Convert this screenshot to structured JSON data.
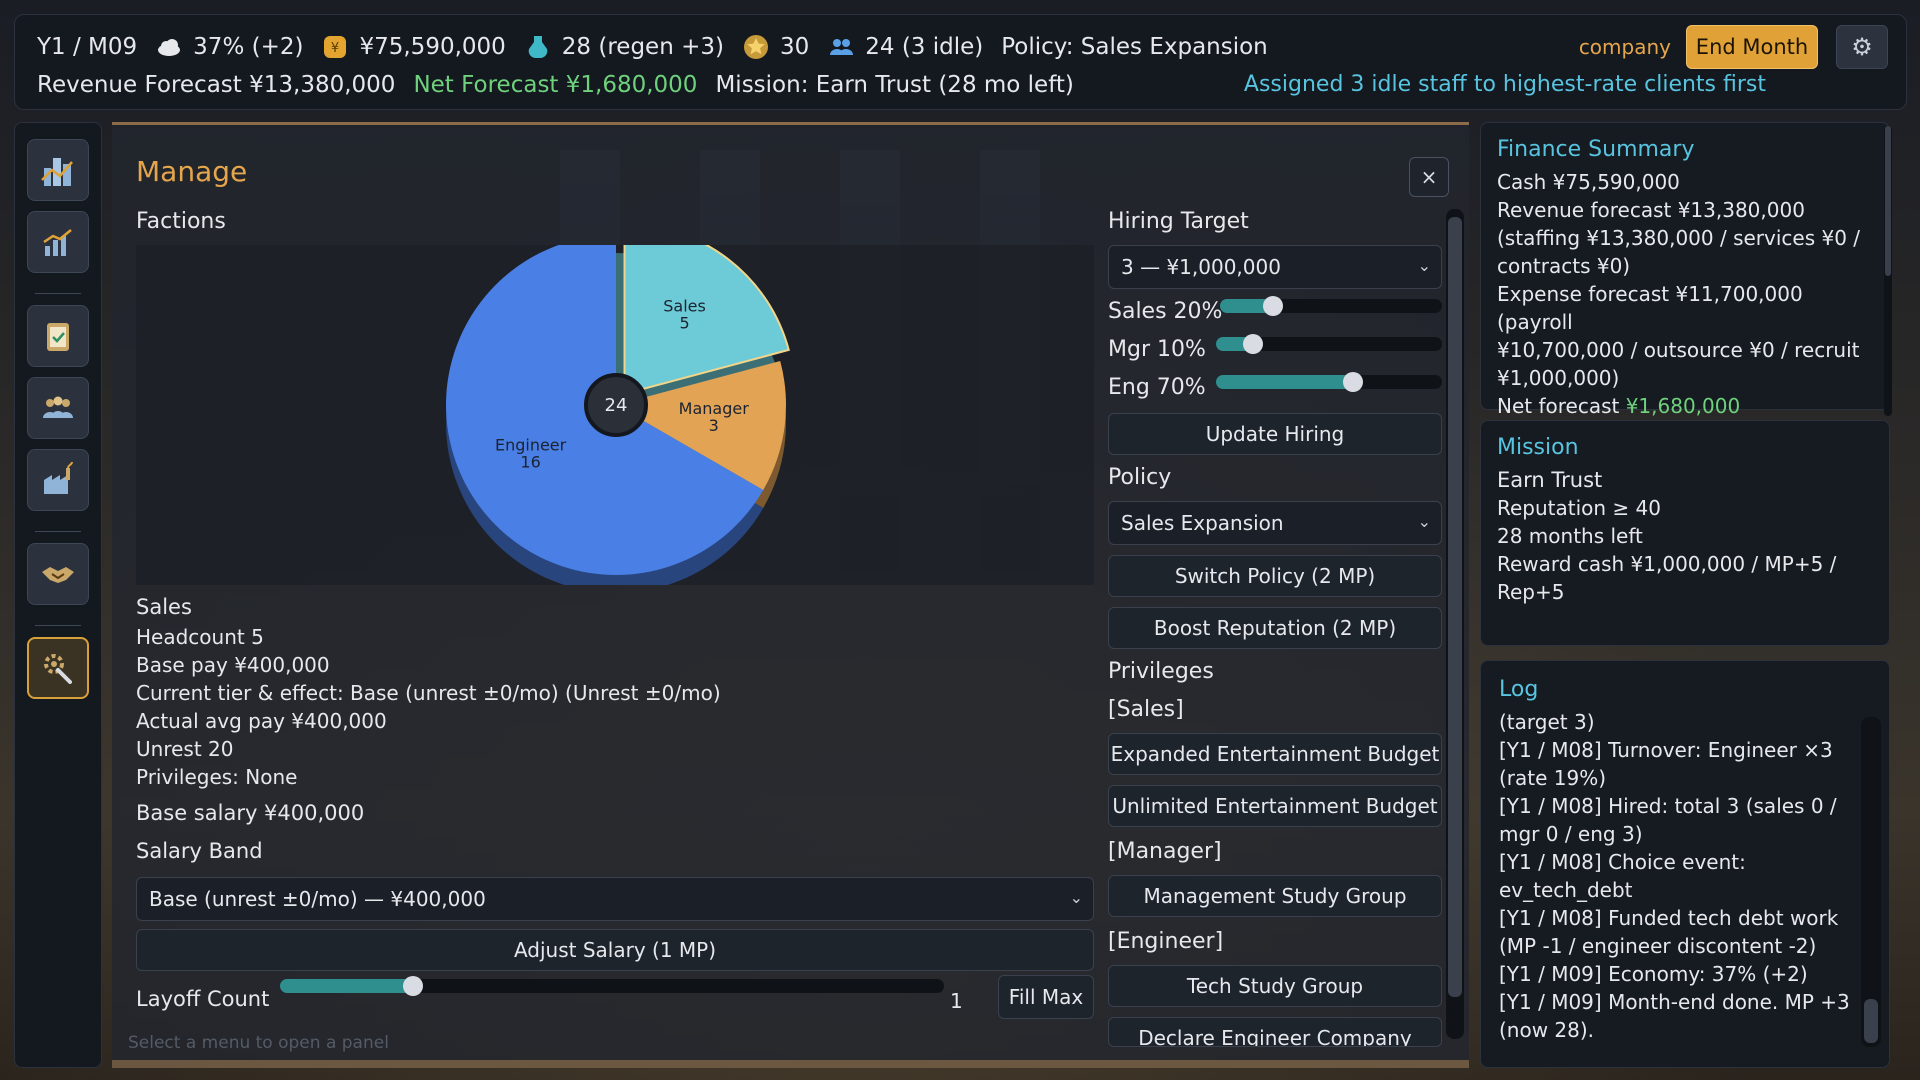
{
  "topbar": {
    "date": "Y1 / M09",
    "economy": "37% (+2)",
    "cash": "¥75,590,000",
    "mp": "28 (regen +3)",
    "reputation": "30",
    "staff": "24 (3 idle)",
    "policy": "Policy: Sales Expansion",
    "revenue_forecast": "Revenue Forecast ¥13,380,000",
    "net_forecast": "Net Forecast ¥1,680,000",
    "mission": "Mission: Earn Trust (28 mo left)",
    "company_label": "company",
    "end_month_label": "End Month",
    "assign_message": "Assigned 3 idle staff to highest-rate clients first"
  },
  "sidebar": {
    "items": [
      {
        "icon": "city-icon"
      },
      {
        "icon": "growth-chart-icon"
      },
      {
        "icon": "clipboard-icon"
      },
      {
        "icon": "team-icon"
      },
      {
        "icon": "factory-icon"
      },
      {
        "icon": "handshake-icon"
      },
      {
        "icon": "wrench-gear-icon",
        "active": true
      }
    ]
  },
  "manage": {
    "title": "Manage",
    "close": "×",
    "factions_label": "Factions",
    "faction": {
      "name": "Sales",
      "headcount": "Headcount 5",
      "base_pay": "Base pay ¥400,000",
      "tier": "Current tier & effect: Base (unrest ±0/mo) (Unrest ±0/mo)",
      "avg_pay": "Actual avg pay ¥400,000",
      "unrest": "Unrest 20",
      "privileges": "Privileges: None"
    },
    "base_salary": "Base salary ¥400,000",
    "salary_band_label": "Salary Band",
    "salary_band_value": "Base (unrest ±0/mo) — ¥400,000",
    "adjust_salary": "Adjust Salary (1 MP)",
    "layoff_label": "Layoff Count",
    "layoff_value": "1",
    "layoff_fraction": 0.2,
    "fill_max": "Fill Max",
    "hint": "Select a menu to open a panel",
    "hiring_target_label": "Hiring Target",
    "hiring_target_value": "3 — ¥1,000,000",
    "sliders": [
      {
        "label": "Sales 20%",
        "value": 20
      },
      {
        "label": "Mgr 10%",
        "value": 10
      },
      {
        "label": "Eng 70%",
        "value": 70
      }
    ],
    "update_hiring": "Update Hiring",
    "policy_label": "Policy",
    "policy_value": "Sales Expansion",
    "switch_policy": "Switch Policy (2 MP)",
    "boost_reputation": "Boost Reputation (2 MP)",
    "privileges_label": "Privileges",
    "priv_sales_label": "[Sales]",
    "priv_sales": [
      "Expanded Entertainment Budget",
      "Unlimited Entertainment Budget"
    ],
    "priv_manager_label": "[Manager]",
    "priv_manager": [
      "Management Study Group"
    ],
    "priv_engineer_label": "[Engineer]",
    "priv_engineer": [
      "Tech Study Group",
      "Declare Engineer Company"
    ]
  },
  "chart_data": {
    "type": "pie",
    "total": "24",
    "slices": [
      {
        "name": "Sales",
        "value": 5,
        "color": "#6ccbd6"
      },
      {
        "name": "Manager",
        "value": 3,
        "color": "#e3a354"
      },
      {
        "name": "Engineer",
        "value": 16,
        "color": "#4a7fe6"
      }
    ]
  },
  "finance": {
    "title": "Finance Summary",
    "cash": "Cash ¥75,590,000",
    "revenue": "Revenue forecast ¥13,380,000",
    "revenue_detail": "(staffing ¥13,380,000 / services ¥0 /",
    "revenue_detail2": "contracts ¥0)",
    "expense": "Expense forecast ¥11,700,000 (payroll",
    "expense2": "¥10,700,000 / outsource ¥0 / recruit",
    "expense3": "¥1,000,000)",
    "net_label": "Net forecast",
    "net_value": "¥1,680,000"
  },
  "mission": {
    "title": "Mission",
    "name": "Earn Trust",
    "req": "Reputation ≥ 40",
    "left": "28 months left",
    "reward1": "Reward cash ¥1,000,000 / MP+5 /",
    "reward2": "Rep+5"
  },
  "log": {
    "title": "Log",
    "lines": [
      "(target 3)",
      "[Y1 / M08] Turnover: Engineer ×3",
      "(rate 19%)",
      "[Y1 / M08] Hired: total 3 (sales 0 /",
      "mgr 0 / eng 3)",
      "[Y1 / M08] Choice event:",
      "ev_tech_debt",
      "[Y1 / M08] Funded tech debt work",
      "(MP -1 / engineer discontent -2)",
      "[Y1 / M09] Economy: 37% (+2)",
      "[Y1 / M09] Month-end done. MP +3",
      "(now 28)."
    ]
  }
}
